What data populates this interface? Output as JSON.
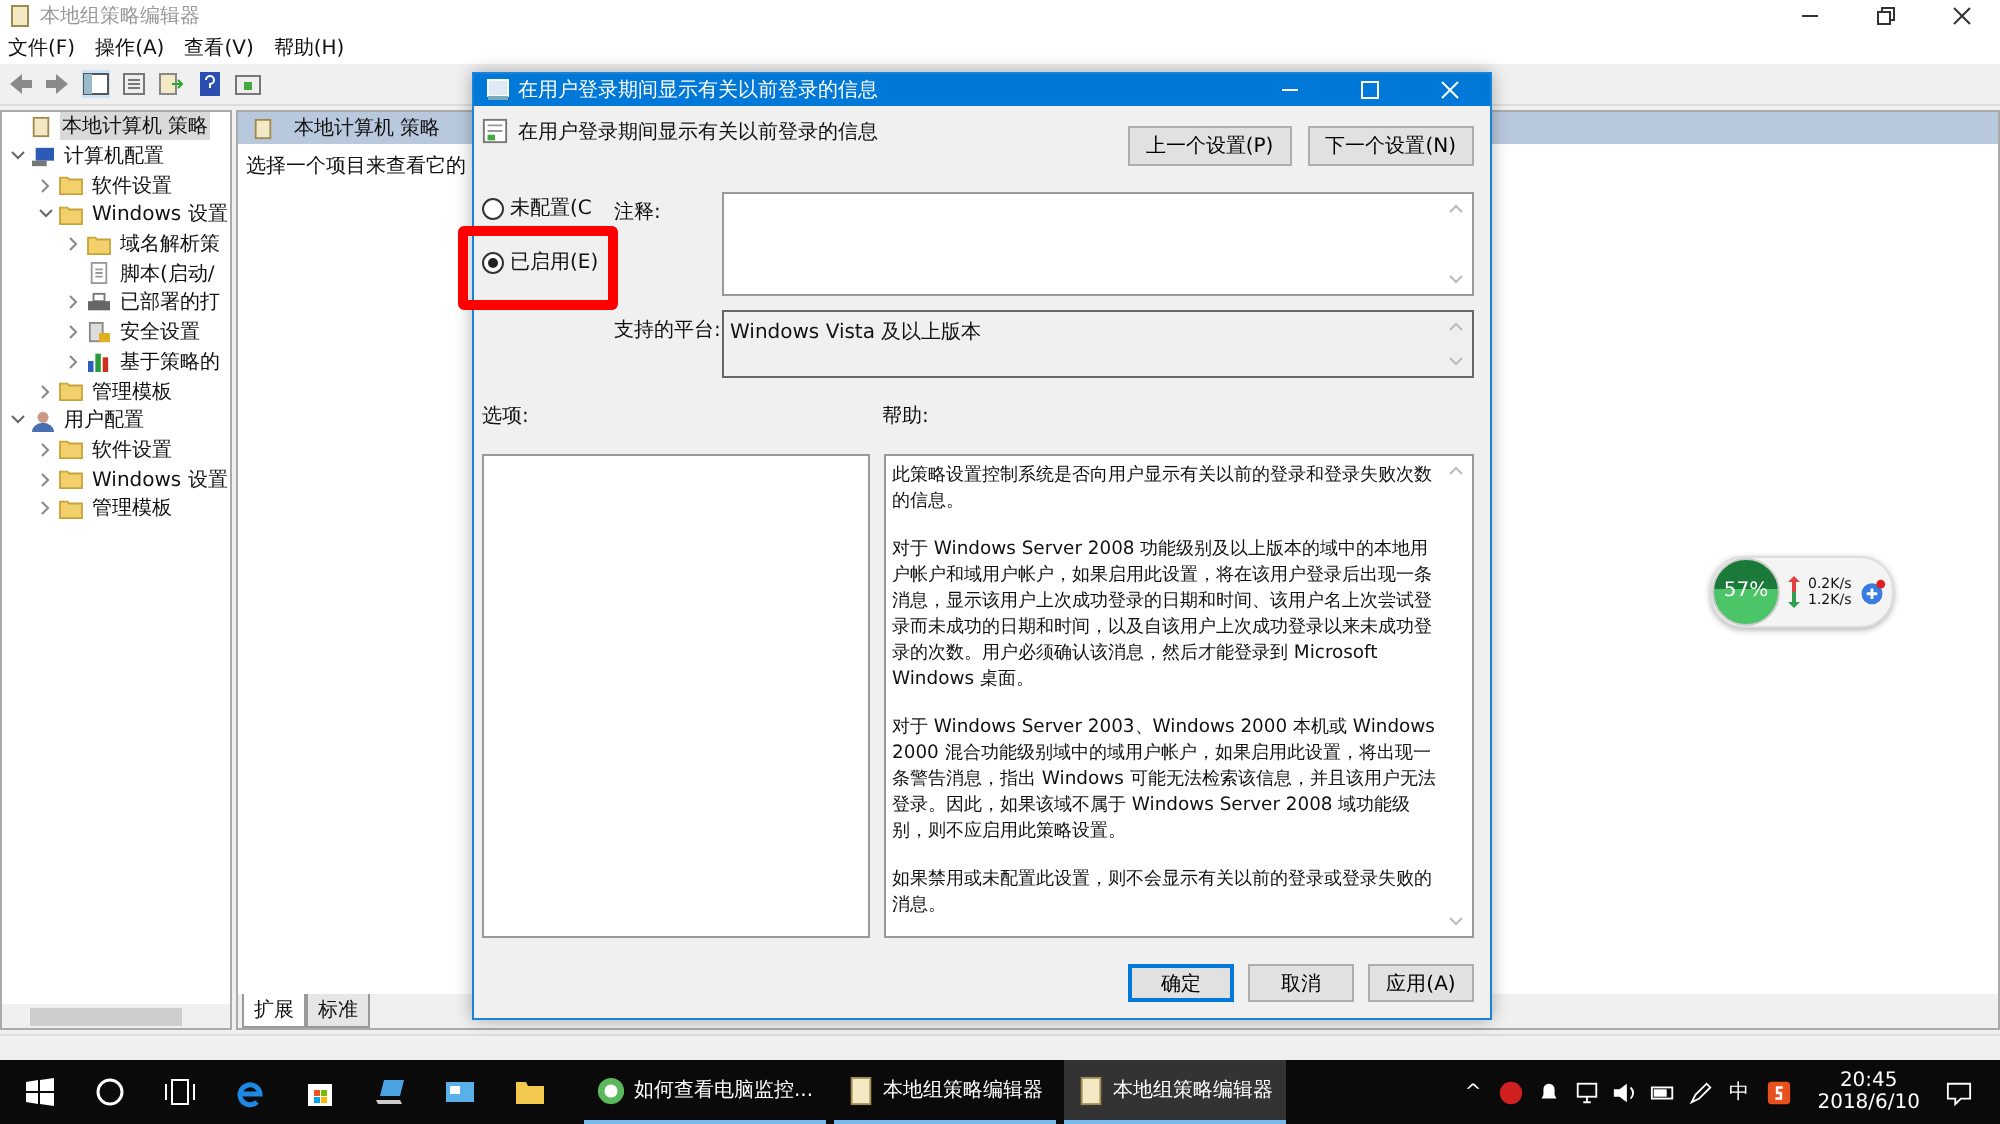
{
  "window": {
    "title": "本地组策略编辑器",
    "menu": [
      "文件(F)",
      "操作(A)",
      "查看(V)",
      "帮助(H)"
    ]
  },
  "tree": [
    {
      "label": "本地计算机 策略",
      "kind": "scroll",
      "selected": true,
      "children": [
        {
          "label": "计算机配置",
          "kind": "computer",
          "expanded": true,
          "selected": false,
          "children": [
            {
              "label": "软件设置",
              "kind": "folder",
              "expanded": false,
              "selected": false
            },
            {
              "label": "Windows 设置",
              "kind": "folder",
              "expanded": true,
              "selected": false,
              "children": [
                {
                  "label": "域名解析策",
                  "kind": "folder",
                  "expanded": false,
                  "selected": false
                },
                {
                  "label": "脚本(启动/",
                  "kind": "script",
                  "selected": false
                },
                {
                  "label": "已部署的打",
                  "kind": "printer",
                  "expanded": false,
                  "selected": false
                },
                {
                  "label": "安全设置",
                  "kind": "security",
                  "expanded": false,
                  "selected": false
                },
                {
                  "label": "基于策略的",
                  "kind": "chart",
                  "expanded": false,
                  "selected": false
                }
              ]
            },
            {
              "label": "管理模板",
              "kind": "folder",
              "expanded": false,
              "selected": false
            }
          ]
        },
        {
          "label": "用户配置",
          "kind": "user",
          "expanded": true,
          "selected": false,
          "children": [
            {
              "label": "软件设置",
              "kind": "folder",
              "expanded": false,
              "selected": false
            },
            {
              "label": "Windows 设置",
              "kind": "folder",
              "expanded": false,
              "selected": false
            },
            {
              "label": "管理模板",
              "kind": "folder",
              "expanded": false,
              "selected": false
            }
          ]
        }
      ]
    }
  ],
  "detail": {
    "header": "本地计算机 策略",
    "text": "选择一个项目来查看它的"
  },
  "view_tabs": [
    {
      "label": "扩展",
      "selected": true
    },
    {
      "label": "标准",
      "selected": false
    }
  ],
  "dialog": {
    "title": "在用户登录期间显示有关以前登录的信息",
    "heading": "在用户登录期间显示有关以前登录的信息",
    "nav_buttons": [
      "上一个设置(P)",
      "下一个设置(N)"
    ],
    "radios": [
      {
        "label": "未配置(C",
        "selected": false
      },
      {
        "label": "已启用(E)",
        "selected": true
      }
    ],
    "comment_label": "注释:",
    "platform_label": "支持的平台:",
    "platform": "Windows Vista 及以上版本",
    "options_label": "选项:",
    "help_label": "帮助:",
    "help": [
      "此策略设置控制系统是否向用户显示有关以前的登录和登录失败次数的信息。",
      "对于 Windows Server 2008 功能级别及以上版本的域中的本地用户帐户和域用户帐户，如果启用此设置，将在该用户登录后出现一条消息，显示该用户上次成功登录的日期和时间、该用户名上次尝试登录而未成功的日期和时间，以及自该用户上次成功登录以来未成功登录的次数。用户必须确认该消息，然后才能登录到 Microsoft Windows 桌面。",
      "对于 Windows Server 2003、Windows 2000 本机或 Windows 2000 混合功能级别域中的域用户帐户，如果启用此设置，将出现一条警告消息，指出 Windows 可能无法检索该信息，并且该用户无法登录。因此，如果该域不属于 Windows Server 2008 域功能级别，则不应启用此策略设置。",
      "如果禁用或未配置此设置，则不会显示有关以前的登录或登录失败的消息。"
    ],
    "buttons": [
      {
        "label": "确定",
        "kind": "default"
      },
      {
        "label": "取消",
        "kind": "normal"
      },
      {
        "label": "应用(A)",
        "kind": "normal"
      }
    ]
  },
  "net_widget": {
    "percent": "57%",
    "upload": "0.2K/s",
    "download": "1.2K/s"
  },
  "taskbar": {
    "apps": [
      {
        "label": "如何查看电脑监控...",
        "kind": "browser",
        "selected": false
      },
      {
        "label": "本地组策略编辑器",
        "kind": "scroll",
        "selected": false
      },
      {
        "label": "本地组策略编辑器",
        "kind": "scroll",
        "selected": true
      }
    ],
    "tray_chevron": "^",
    "ime": "中",
    "time": "20:45",
    "date": "2018/6/10"
  }
}
